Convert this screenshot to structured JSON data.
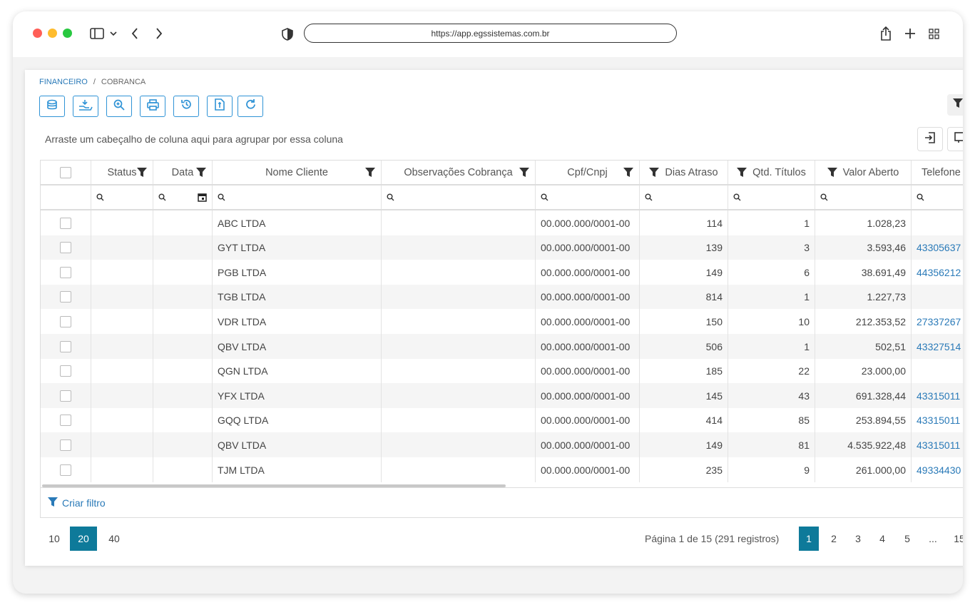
{
  "browser": {
    "url": "https://app.egssistemas.com.br",
    "colors": {
      "close": "#ff5f57",
      "minimize": "#febc2e",
      "maximize": "#28c840"
    }
  },
  "breadcrumb": {
    "root": "FINANCEIRO",
    "separator": "/",
    "current": "COBRANCA"
  },
  "toolbar": {
    "icons": [
      "coins-icon",
      "hand-money-icon",
      "zoom-icon",
      "print-icon",
      "history-icon",
      "document-icon",
      "refresh-icon"
    ]
  },
  "grid": {
    "group_hint": "Arraste um cabeçalho de coluna aqui para agrupar por essa coluna",
    "columns": {
      "status": "Status",
      "data": "Data",
      "nome": "Nome Cliente",
      "obs": "Observações Cobrança",
      "cpf": "Cpf/Cnpj",
      "dias": "Dias Atraso",
      "qtd": "Qtd. Títulos",
      "valor": "Valor Aberto",
      "telefone": "Telefone"
    },
    "rows": [
      {
        "nome": "ABC LTDA",
        "cpf": "00.000.000/0001-00",
        "dias": "114",
        "qtd": "1",
        "valor": "1.028,23",
        "tel": ""
      },
      {
        "nome": "GYT LTDA",
        "cpf": "00.000.000/0001-00",
        "dias": "139",
        "qtd": "3",
        "valor": "3.593,46",
        "tel": "43305637"
      },
      {
        "nome": "PGB LTDA",
        "cpf": "00.000.000/0001-00",
        "dias": "149",
        "qtd": "6",
        "valor": "38.691,49",
        "tel": "44356212"
      },
      {
        "nome": "TGB LTDA",
        "cpf": "00.000.000/0001-00",
        "dias": "814",
        "qtd": "1",
        "valor": "1.227,73",
        "tel": ""
      },
      {
        "nome": "VDR LTDA",
        "cpf": "00.000.000/0001-00",
        "dias": "150",
        "qtd": "10",
        "valor": "212.353,52",
        "tel": "27337267"
      },
      {
        "nome": "QBV LTDA",
        "cpf": "00.000.000/0001-00",
        "dias": "506",
        "qtd": "1",
        "valor": "502,51",
        "tel": "43327514"
      },
      {
        "nome": "QGN LTDA",
        "cpf": "00.000.000/0001-00",
        "dias": "185",
        "qtd": "22",
        "valor": "23.000,00",
        "tel": ""
      },
      {
        "nome": "YFX LTDA",
        "cpf": "00.000.000/0001-00",
        "dias": "145",
        "qtd": "43",
        "valor": "691.328,44",
        "tel": "43315011"
      },
      {
        "nome": "GQQ LTDA",
        "cpf": "00.000.000/0001-00",
        "dias": "414",
        "qtd": "85",
        "valor": "253.894,55",
        "tel": "43315011"
      },
      {
        "nome": "QBV LTDA",
        "cpf": "00.000.000/0001-00",
        "dias": "149",
        "qtd": "81",
        "valor": "4.535.922,48",
        "tel": "43315011"
      },
      {
        "nome": "TJM LTDA",
        "cpf": "00.000.000/0001-00",
        "dias": "235",
        "qtd": "9",
        "valor": "261.000,00",
        "tel": "49334430"
      }
    ]
  },
  "filter": {
    "create_label": "Criar filtro"
  },
  "pager": {
    "sizes": [
      "10",
      "20",
      "40"
    ],
    "active_size": "20",
    "info": "Página 1 de 15 (291 registros)",
    "pages": [
      "1",
      "2",
      "3",
      "4",
      "5"
    ],
    "ellipsis": "...",
    "last": "15"
  },
  "theme": {
    "accent": "#0e7a9a",
    "toolbar_border": "#2f93d6",
    "link": "#2a7ab8"
  }
}
